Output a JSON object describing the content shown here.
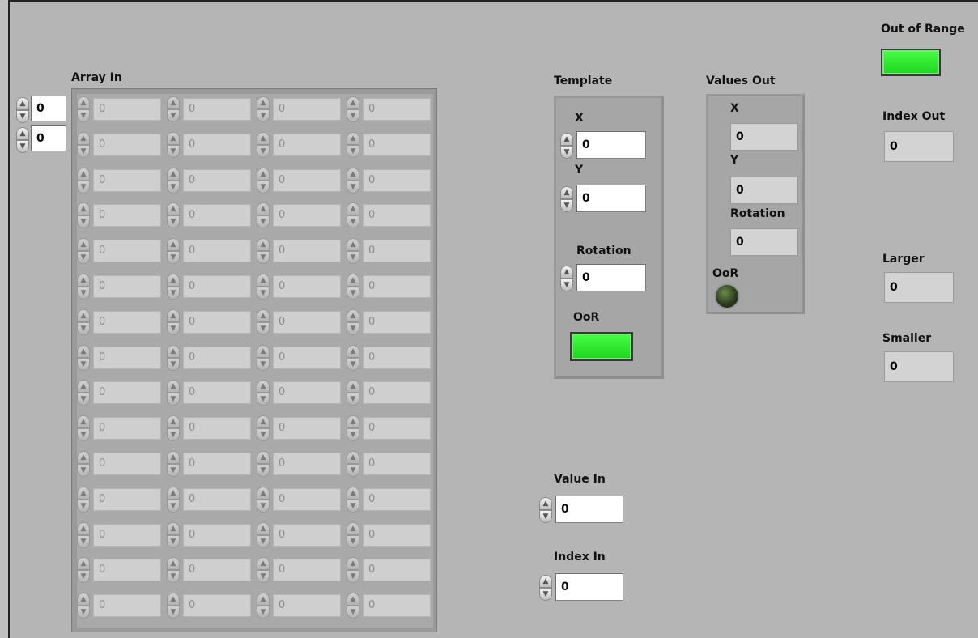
{
  "array_in": {
    "label": "Array In",
    "index_values": [
      "0",
      "0"
    ],
    "cell_value": "0",
    "rows": 15,
    "cols": 4
  },
  "template": {
    "label": "Template",
    "x_label": "X",
    "x_value": "0",
    "y_label": "Y",
    "y_value": "0",
    "rotation_label": "Rotation",
    "rotation_value": "0",
    "oor_label": "OoR",
    "oor_state": "on"
  },
  "values_out": {
    "label": "Values Out",
    "x_label": "X",
    "x_value": "0",
    "y_label": "Y",
    "y_value": "0",
    "rotation_label": "Rotation",
    "rotation_value": "0",
    "oor_label": "OoR",
    "oor_state": "off"
  },
  "value_in": {
    "label": "Value In",
    "value": "0"
  },
  "index_in": {
    "label": "Index In",
    "value": "0"
  },
  "out_of_range": {
    "label": "Out of Range",
    "state": "on"
  },
  "index_out": {
    "label": "Index Out",
    "value": "0"
  },
  "larger": {
    "label": "Larger",
    "value": "0"
  },
  "smaller": {
    "label": "Smaller",
    "value": "0"
  },
  "colors": {
    "led_on": "#2ee82e",
    "led_off": "#2c3d1e",
    "panel_bg": "#b5b5b5"
  }
}
